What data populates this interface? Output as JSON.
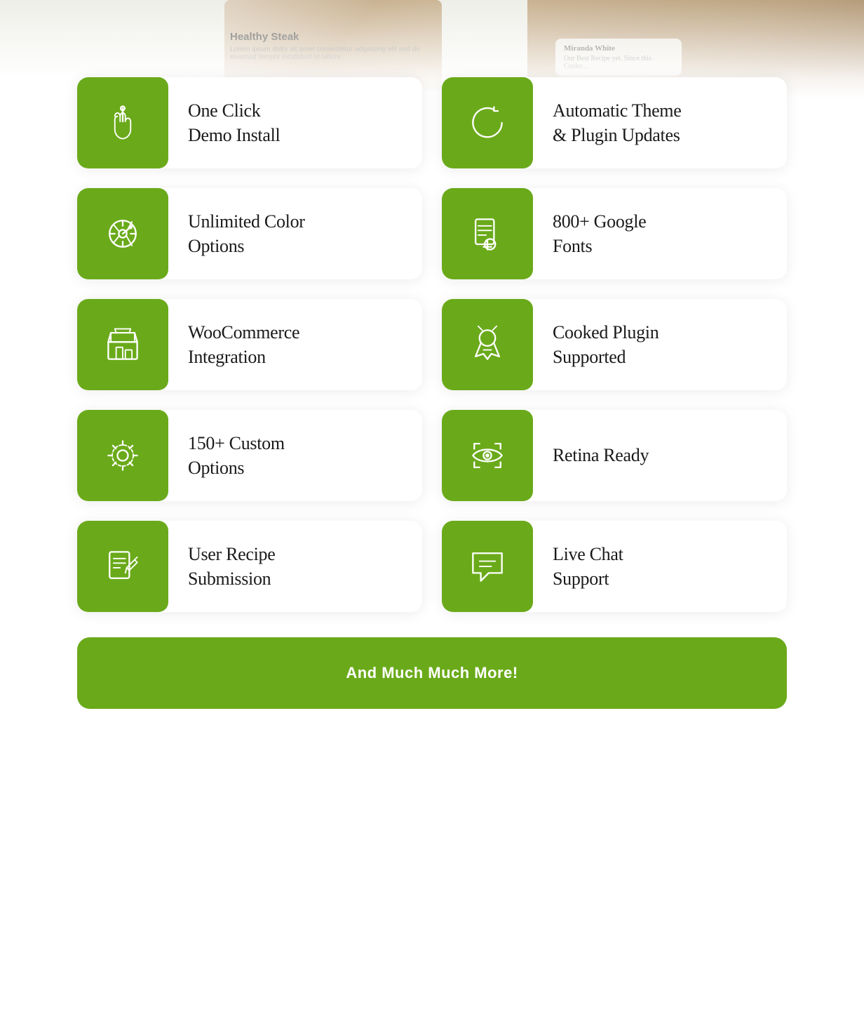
{
  "header": {
    "title": "Healthy Steak"
  },
  "features": [
    {
      "id": "one-click-demo",
      "label": "One Click\nDemo Install",
      "icon": "hand-pointer"
    },
    {
      "id": "auto-updates",
      "label": "Automatic Theme\n& Plugin Updates",
      "icon": "refresh"
    },
    {
      "id": "color-options",
      "label": "Unlimited Color\nOptions",
      "icon": "color-wheel"
    },
    {
      "id": "google-fonts",
      "label": "800+ Google\nFonts",
      "icon": "recipe-book"
    },
    {
      "id": "woocommerce",
      "label": "WooCommerce\nIntegration",
      "icon": "store"
    },
    {
      "id": "cooked-plugin",
      "label": "Cooked Plugin\nSupported",
      "icon": "chef"
    },
    {
      "id": "custom-options",
      "label": "150+ Custom\nOptions",
      "icon": "settings"
    },
    {
      "id": "retina",
      "label": "Retina Ready",
      "icon": "eye-scan"
    },
    {
      "id": "recipe-submission",
      "label": "User Recipe\nSubmission",
      "icon": "recipe-submit"
    },
    {
      "id": "live-chat",
      "label": "Live Chat\nSupport",
      "icon": "chat"
    }
  ],
  "more_button": {
    "label": "And Much Much More!"
  },
  "colors": {
    "green": "#6aaa1a",
    "text_dark": "#1a1a1a",
    "card_bg": "#ffffff"
  }
}
